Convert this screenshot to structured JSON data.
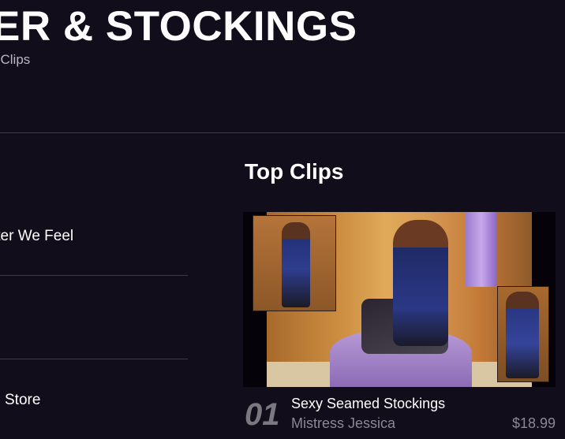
{
  "header": {
    "title": "ER & STOCKINGS",
    "subtitle": "l Clips"
  },
  "sidebar": {
    "items": [
      {
        "label": "tter We Feel"
      },
      {
        "label": "Store"
      }
    ]
  },
  "top_clips": {
    "heading": "Top Clips",
    "clips": [
      {
        "rank": "01",
        "title": "Sexy Seamed Stockings",
        "author": "Mistress Jessica",
        "price": "$18.99"
      }
    ]
  },
  "colors": {
    "background": "#120d1b",
    "divider": "#3e3a47",
    "muted_text": "#8b8893"
  }
}
